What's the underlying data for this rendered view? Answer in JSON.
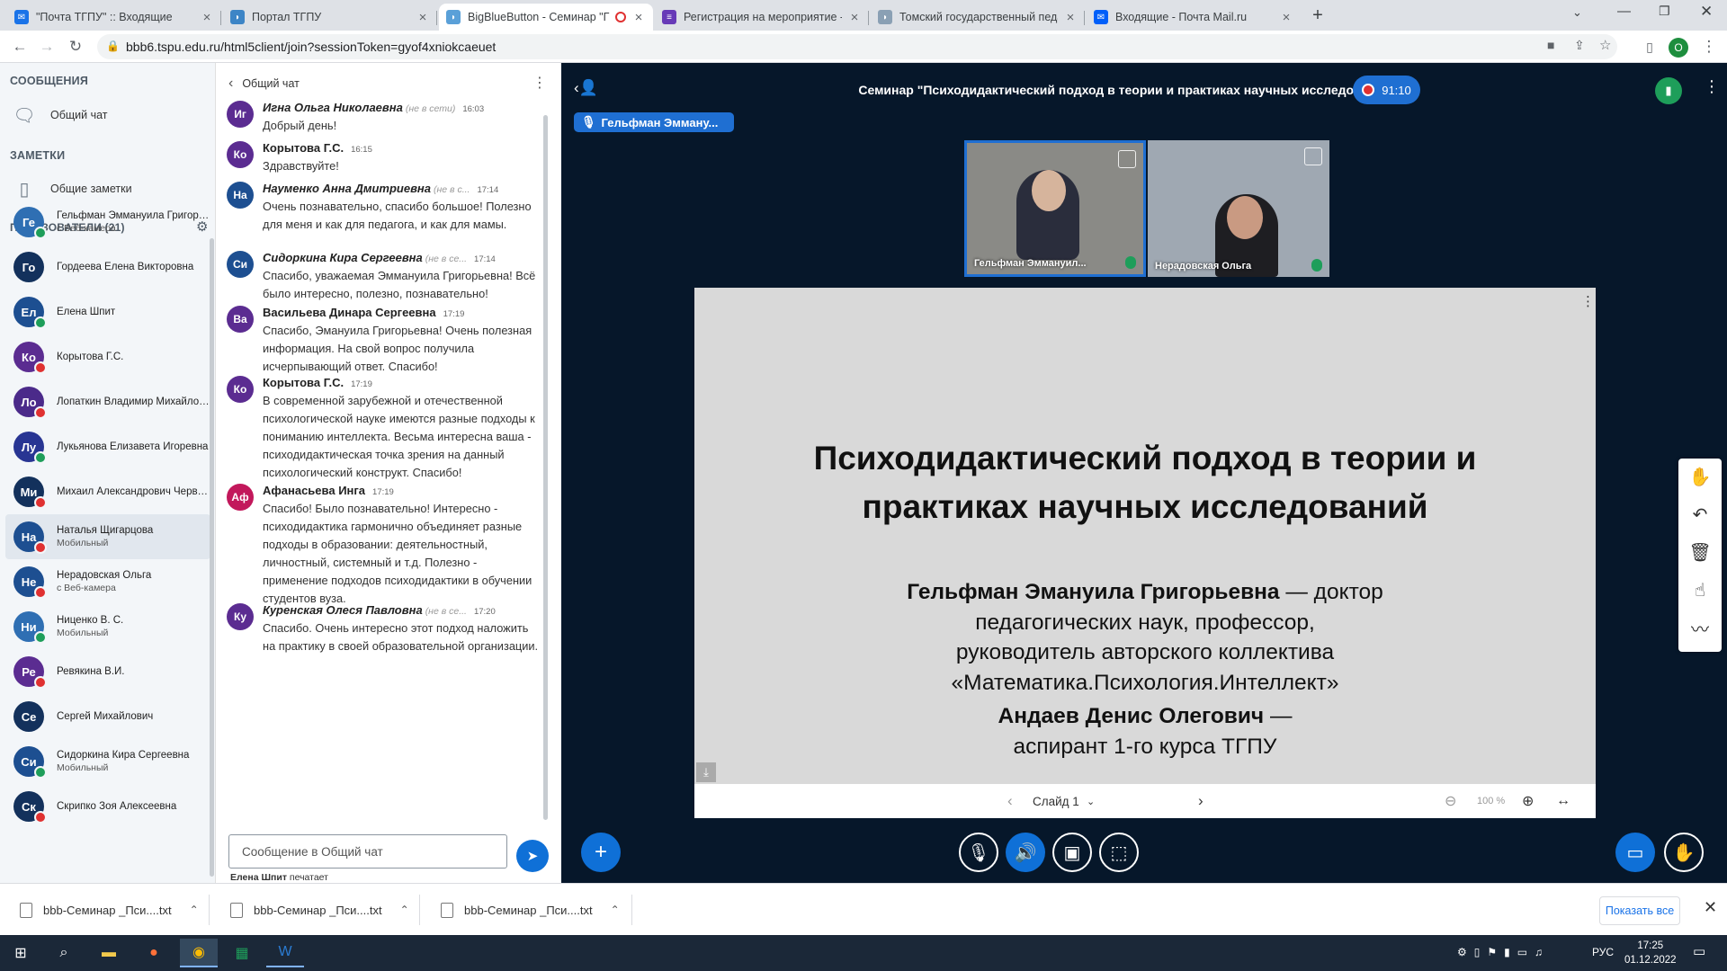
{
  "browser": {
    "tabs": [
      {
        "title": "\"Почта ТГПУ\" :: Входящие",
        "favicon_color": "#1a73e8"
      },
      {
        "title": "Портал ТГПУ",
        "favicon_color": "#3d85c6"
      },
      {
        "title": "BigBlueButton - Семинар \"Г",
        "favicon_color": "#5aa0d8"
      },
      {
        "title": "Регистрация на мероприятие - ",
        "favicon_color": "#673ab7"
      },
      {
        "title": "Томский государственный педа",
        "favicon_color": "#8aa0b4"
      },
      {
        "title": "Входящие - Почта Mail.ru",
        "favicon_color": "#005ff9"
      }
    ],
    "new_tab_label": "+",
    "url": "bbb6.tspu.edu.ru/html5client/join?sessionToken=gyof4xniokcaeuet",
    "profile_initial": "O"
  },
  "sidebar": {
    "messages_title": "СООБЩЕНИЯ",
    "public_chat": "Общий чат",
    "notes_title": "ЗАМЕТКИ",
    "shared_notes": "Общие заметки",
    "users_title": "ПОЛЬЗОВАТЕЛИ (21)",
    "users": [
      {
        "initials": "Ге",
        "name": "Гельфман Эммануила Григорь...",
        "sub": "с Веб-камера",
        "color": "#2f6fb3",
        "status": "#1e9e5a"
      },
      {
        "initials": "Го",
        "name": "Гордеева Елена Викторовна",
        "sub": "",
        "color": "#13315c",
        "status": ""
      },
      {
        "initials": "Ел",
        "name": "Елена Шпит",
        "sub": "",
        "color": "#1d4f91",
        "status": "#1e9e5a"
      },
      {
        "initials": "Ко",
        "name": "Корытова Г.С.",
        "sub": "",
        "color": "#5b2c91",
        "status": "#e03131"
      },
      {
        "initials": "Ло",
        "name": "Лопаткин Владимир Михайлов...",
        "sub": "",
        "color": "#4b2a8a",
        "status": "#e03131"
      },
      {
        "initials": "Лу",
        "name": "Лукьянова Елизавета Игоревна",
        "sub": "",
        "color": "#283593",
        "status": "#1e9e5a"
      },
      {
        "initials": "Ми",
        "name": "Михаил Александрович Черво...",
        "sub": "",
        "color": "#13315c",
        "status": "#e03131"
      },
      {
        "initials": "На",
        "name": "Наталья Щигарцова",
        "sub": "Мобильный",
        "color": "#1d4f91",
        "status": "#e03131"
      },
      {
        "initials": "Не",
        "name": "Нерадовская Ольга",
        "sub": "с Веб-камера",
        "color": "#1d4f91",
        "status": "#e03131"
      },
      {
        "initials": "Ни",
        "name": "Ниценко В. С.",
        "sub": "Мобильный",
        "color": "#2f6fb3",
        "status": "#1e9e5a"
      },
      {
        "initials": "Ре",
        "name": "Ревякина В.И.",
        "sub": "",
        "color": "#5b2c91",
        "status": "#e03131"
      },
      {
        "initials": "Се",
        "name": "Сергей Михайлович",
        "sub": "",
        "color": "#13315c",
        "status": ""
      },
      {
        "initials": "Си",
        "name": "Сидоркина Кира Сергеевна",
        "sub": "Мобильный",
        "color": "#1d4f91",
        "status": "#1e9e5a"
      },
      {
        "initials": "Ск",
        "name": "Скрипко Зоя Алексеевна",
        "sub": "",
        "color": "#13315c",
        "status": "#e03131"
      }
    ]
  },
  "chat": {
    "title": "Общий чат",
    "messages": [
      {
        "initials": "Иг",
        "author": "Игна Ольга Николаевна",
        "offline": "(не в сети)",
        "time": "16:03",
        "text": "Добрый день!",
        "color": "#5b2c91",
        "italic": true
      },
      {
        "initials": "Ко",
        "author": "Корытова Г.С.",
        "offline": "",
        "time": "16:15",
        "text": "Здравствуйте!",
        "color": "#5b2c91",
        "italic": false
      },
      {
        "initials": "На",
        "author": "Науменко Анна Дмитриевна",
        "offline": "(не в с...",
        "time": "17:14",
        "text": "Очень познавательно, спасибо большое! Полезно для меня и как для педагога, и как для мамы.",
        "color": "#1d4f91",
        "italic": true
      },
      {
        "initials": "Си",
        "author": "Сидоркина Кира Сергеевна",
        "offline": "(не в се...",
        "time": "17:14",
        "text": "Спасибо, уважаемая Эммануила Григорьевна! Всё было интересно, полезно, познавательно!",
        "color": "#1d4f91",
        "italic": true
      },
      {
        "initials": "Ва",
        "author": "Васильева Динара Сергеевна",
        "offline": "",
        "time": "17:19",
        "text": "Спасибо, Эмануила Григорьевна! Очень полезная информация. На свой вопрос получила исчерпывающий ответ. Спасибо!",
        "color": "#5b2c91",
        "italic": false
      },
      {
        "initials": "Ко",
        "author": "Корытова Г.С.",
        "offline": "",
        "time": "17:19",
        "text": "В современной зарубежной и отечественной психологической науке имеются разные подходы к пониманию интеллекта. Весьма интересна ваша - психодидактическая точка зрения на данный психологический конструкт. Спасибо!",
        "color": "#5b2c91",
        "italic": false
      },
      {
        "initials": "Аф",
        "author": "Афанасьева Инга",
        "offline": "",
        "time": "17:19",
        "text": "Спасибо! Было познавательно! Интересно - психодидактика гармонично объединяет разные подходы в образовании: деятельностный, личностный, системный и т.д. Полезно - применение подходов психодидактики в обучении студентов вуза.",
        "color": "#c2185b",
        "italic": false
      },
      {
        "initials": "Ку",
        "author": "Куренская Олеся Павловна",
        "offline": "(не в се...",
        "time": "17:20",
        "text": "Спасибо. Очень интересно этот подход наложить на практику в своей образовательной организации.",
        "color": "#5b2c91",
        "italic": true
      }
    ],
    "input_placeholder": "Сообщение в Общий чат",
    "typing_name": "Елена Шпит",
    "typing_suffix": " печатает"
  },
  "conference": {
    "title": "Семинар \"Психодидактический подход в теории и практиках научных исследований\"",
    "recording_time": "91:10",
    "talking": "Гельфман Эмману...",
    "videos": [
      {
        "label": "Гельфман Эммануил...",
        "bg": "#8a8a86"
      },
      {
        "label": "Нерадовская Ольга",
        "bg": "#9fa8b2"
      }
    ],
    "slide": {
      "title_line1": "Психодидактический подход в теории и",
      "title_line2": "практиках научных исследований",
      "author1_bold": "Гельфман Эмануила Григорьевна",
      "author1_rest": " — доктор",
      "line2": "педагогических наук, профессор,",
      "line3": "руководитель авторского коллектива",
      "line4": "«Математика.Психология.Интеллект»",
      "author2_bold": "Андаев Денис Олегович",
      "author2_rest": " —",
      "line6": "аспирант 1-го курса ТГПУ"
    },
    "slide_selector": "Слайд 1",
    "zoom": "100 %"
  },
  "downloads": {
    "items": [
      "bbb-Семинар _Пси....txt",
      "bbb-Семинар _Пси....txt",
      "bbb-Семинар _Пси....txt"
    ],
    "show_all": "Показать все"
  },
  "taskbar": {
    "lang": "РУС",
    "time": "17:25",
    "date": "01.12.2022"
  }
}
